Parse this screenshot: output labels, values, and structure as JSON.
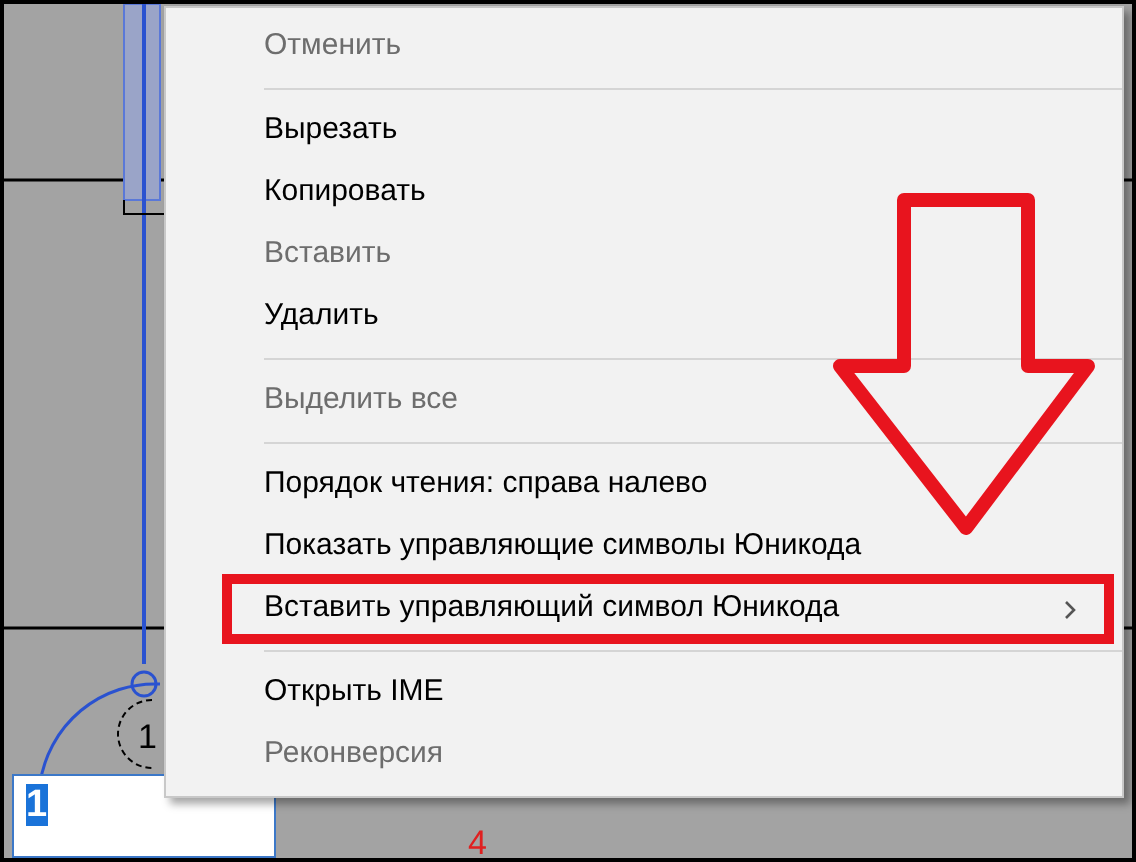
{
  "drawing": {
    "labels": [
      {
        "text": "1",
        "color": "#000000"
      },
      {
        "text": "4",
        "color": "#e02020"
      }
    ]
  },
  "text_field": {
    "value": "1",
    "selected": true
  },
  "context_menu": {
    "items": [
      {
        "kind": "item",
        "label": "Отменить",
        "disabled": true
      },
      {
        "kind": "separator"
      },
      {
        "kind": "item",
        "label": "Вырезать",
        "disabled": false
      },
      {
        "kind": "item",
        "label": "Копировать",
        "disabled": false
      },
      {
        "kind": "item",
        "label": "Вставить",
        "disabled": true
      },
      {
        "kind": "item",
        "label": "Удалить",
        "disabled": false
      },
      {
        "kind": "separator"
      },
      {
        "kind": "item",
        "label": "Выделить все",
        "disabled": true
      },
      {
        "kind": "separator"
      },
      {
        "kind": "item",
        "label": "Порядок чтения: справа налево",
        "disabled": false
      },
      {
        "kind": "item",
        "label": "Показать управляющие символы Юникода",
        "disabled": false
      },
      {
        "kind": "item",
        "label": "Вставить управляющий символ Юникода",
        "disabled": false,
        "has_submenu": true,
        "highlighted": true
      },
      {
        "kind": "separator"
      },
      {
        "kind": "item",
        "label": "Открыть IME",
        "disabled": false
      },
      {
        "kind": "item",
        "label": "Реконверсия",
        "disabled": true
      }
    ]
  },
  "annotation": {
    "arrow": true
  }
}
